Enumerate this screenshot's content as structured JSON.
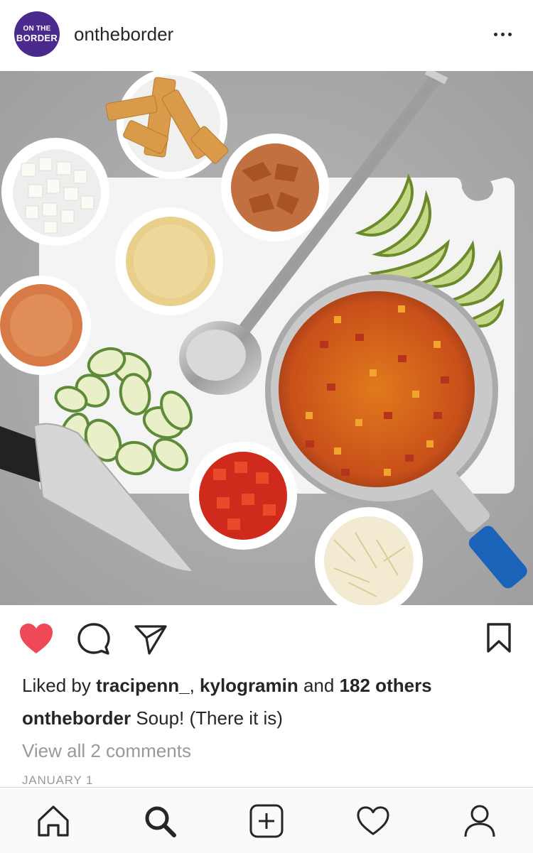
{
  "header": {
    "username": "ontheborder",
    "avatar_line1": "ON THE",
    "avatar_line2": "BORDER",
    "avatar_color": "#4b2a8e",
    "more_icon": "more-horizontal-icon"
  },
  "post": {
    "image_subject": "soup ingredients",
    "like_color": "#ed4956",
    "liked_by_prefix": "Liked by ",
    "liked_user_1": "tracipenn_",
    "liked_sep": ", ",
    "liked_user_2": "kylogramin",
    "liked_and": " and ",
    "liked_others": "182 others",
    "caption_user": "ontheborder",
    "caption_text": " Soup! (There it is)",
    "view_comments": "View all 2 comments",
    "date": "JANUARY 1"
  },
  "nav": {
    "items": [
      "home-icon",
      "search-icon",
      "new-post-icon",
      "activity-icon",
      "profile-icon"
    ]
  }
}
